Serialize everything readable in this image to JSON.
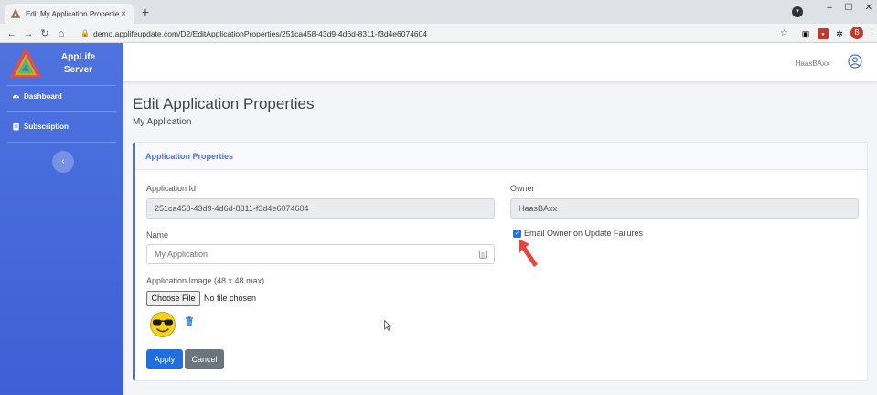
{
  "browser": {
    "tab_title": "Edit My Application Properties",
    "tab_close": "×",
    "new_tab": "+",
    "url": "demo.applifeupdate.com/D2/EditApplicationProperties/251ca458-43d9-4d6d-8311-f3d4e6074604",
    "window_controls": {
      "minimize": "–",
      "maximize": "☐",
      "close": "✕"
    },
    "profile_initial": "B"
  },
  "sidebar": {
    "brand_line1": "AppLife",
    "brand_line2": "Server",
    "items": [
      {
        "label": "Dashboard",
        "icon": "dashboard-icon"
      },
      {
        "label": "Subscription",
        "icon": "subscription-icon"
      }
    ],
    "collapse_glyph": "‹"
  },
  "topbar": {
    "user_name": "HaasBAxx"
  },
  "page": {
    "title": "Edit Application Properties",
    "subtitle": "My Application"
  },
  "card": {
    "header": "Application Properties",
    "app_id_label": "Application Id",
    "app_id_value": "251ca458-43d9-4d6d-8311-f3d4e6074604",
    "owner_label": "Owner",
    "owner_value": "HaasBAxx",
    "name_label": "Name",
    "name_value": "My Application",
    "email_owner_label": "Email Owner on Update Failures",
    "email_owner_checked": true,
    "image_label": "Application Image (48 x 48 max)",
    "choose_file_label": "Choose File",
    "no_file_label": "No file chosen",
    "apply_label": "Apply",
    "cancel_label": "Cancel"
  },
  "colors": {
    "sidebar": "#4e73df",
    "primary_button": "#1f6fe0",
    "secondary_button": "#6c757d",
    "annotation_arrow": "#e8453c"
  }
}
